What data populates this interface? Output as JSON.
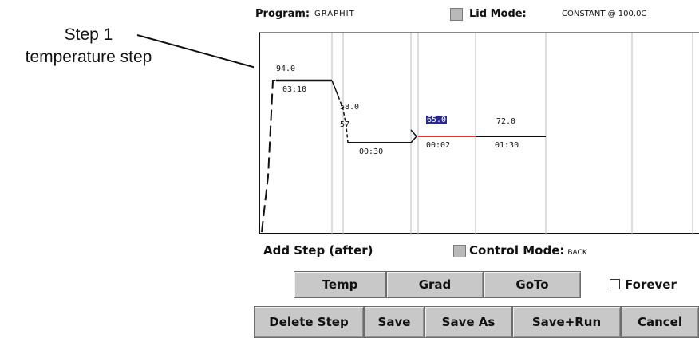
{
  "callout": {
    "line1": "Step 1",
    "line2": "temperature step"
  },
  "topbar": {
    "program_label": "Program:",
    "program_name": "GRAPHIT",
    "lid_mode_label": "Lid Mode:",
    "lid_mode_value": "CONSTANT @ 100.0C"
  },
  "graph": {
    "steps": [
      {
        "temp": "94.0",
        "time": "03:10",
        "selected": false
      },
      {
        "temp": "58.0",
        "time": "",
        "selected": false
      },
      {
        "temp": "57",
        "time": "",
        "selected": false
      },
      {
        "temp": "",
        "time": "00:30",
        "selected": false
      },
      {
        "temp": "65.0",
        "time": "00:02",
        "selected": true
      },
      {
        "temp": "72.0",
        "time": "01:30",
        "selected": false
      }
    ]
  },
  "row1": {
    "add_step": "Add Step (after)",
    "control_mode_label": "Control Mode:",
    "control_mode_value": "BACK"
  },
  "buttons": {
    "temp": "Temp",
    "grad": "Grad",
    "goto": "GoTo",
    "forever": "Forever",
    "delete_step": "Delete Step",
    "save": "Save",
    "save_as": "Save As",
    "save_run": "Save+Run",
    "cancel": "Cancel"
  },
  "colors": {
    "selected_step": "#2a2a8c",
    "goto_segment": "#e03030"
  }
}
